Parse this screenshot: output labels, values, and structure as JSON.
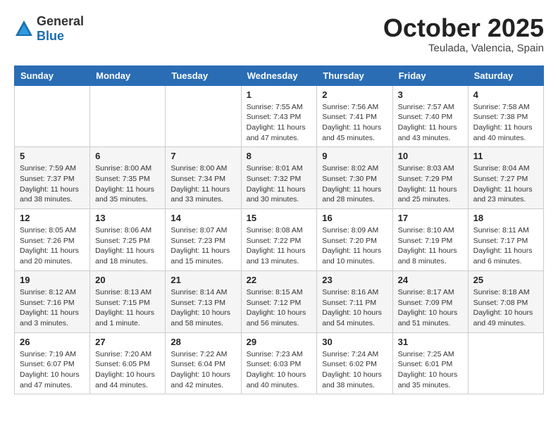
{
  "logo": {
    "text_general": "General",
    "text_blue": "Blue"
  },
  "header": {
    "month_year": "October 2025",
    "location": "Teulada, Valencia, Spain"
  },
  "weekdays": [
    "Sunday",
    "Monday",
    "Tuesday",
    "Wednesday",
    "Thursday",
    "Friday",
    "Saturday"
  ],
  "weeks": [
    [
      {
        "day": "",
        "info": ""
      },
      {
        "day": "",
        "info": ""
      },
      {
        "day": "",
        "info": ""
      },
      {
        "day": "1",
        "info": "Sunrise: 7:55 AM\nSunset: 7:43 PM\nDaylight: 11 hours\nand 47 minutes."
      },
      {
        "day": "2",
        "info": "Sunrise: 7:56 AM\nSunset: 7:41 PM\nDaylight: 11 hours\nand 45 minutes."
      },
      {
        "day": "3",
        "info": "Sunrise: 7:57 AM\nSunset: 7:40 PM\nDaylight: 11 hours\nand 43 minutes."
      },
      {
        "day": "4",
        "info": "Sunrise: 7:58 AM\nSunset: 7:38 PM\nDaylight: 11 hours\nand 40 minutes."
      }
    ],
    [
      {
        "day": "5",
        "info": "Sunrise: 7:59 AM\nSunset: 7:37 PM\nDaylight: 11 hours\nand 38 minutes."
      },
      {
        "day": "6",
        "info": "Sunrise: 8:00 AM\nSunset: 7:35 PM\nDaylight: 11 hours\nand 35 minutes."
      },
      {
        "day": "7",
        "info": "Sunrise: 8:00 AM\nSunset: 7:34 PM\nDaylight: 11 hours\nand 33 minutes."
      },
      {
        "day": "8",
        "info": "Sunrise: 8:01 AM\nSunset: 7:32 PM\nDaylight: 11 hours\nand 30 minutes."
      },
      {
        "day": "9",
        "info": "Sunrise: 8:02 AM\nSunset: 7:30 PM\nDaylight: 11 hours\nand 28 minutes."
      },
      {
        "day": "10",
        "info": "Sunrise: 8:03 AM\nSunset: 7:29 PM\nDaylight: 11 hours\nand 25 minutes."
      },
      {
        "day": "11",
        "info": "Sunrise: 8:04 AM\nSunset: 7:27 PM\nDaylight: 11 hours\nand 23 minutes."
      }
    ],
    [
      {
        "day": "12",
        "info": "Sunrise: 8:05 AM\nSunset: 7:26 PM\nDaylight: 11 hours\nand 20 minutes."
      },
      {
        "day": "13",
        "info": "Sunrise: 8:06 AM\nSunset: 7:25 PM\nDaylight: 11 hours\nand 18 minutes."
      },
      {
        "day": "14",
        "info": "Sunrise: 8:07 AM\nSunset: 7:23 PM\nDaylight: 11 hours\nand 15 minutes."
      },
      {
        "day": "15",
        "info": "Sunrise: 8:08 AM\nSunset: 7:22 PM\nDaylight: 11 hours\nand 13 minutes."
      },
      {
        "day": "16",
        "info": "Sunrise: 8:09 AM\nSunset: 7:20 PM\nDaylight: 11 hours\nand 10 minutes."
      },
      {
        "day": "17",
        "info": "Sunrise: 8:10 AM\nSunset: 7:19 PM\nDaylight: 11 hours\nand 8 minutes."
      },
      {
        "day": "18",
        "info": "Sunrise: 8:11 AM\nSunset: 7:17 PM\nDaylight: 11 hours\nand 6 minutes."
      }
    ],
    [
      {
        "day": "19",
        "info": "Sunrise: 8:12 AM\nSunset: 7:16 PM\nDaylight: 11 hours\nand 3 minutes."
      },
      {
        "day": "20",
        "info": "Sunrise: 8:13 AM\nSunset: 7:15 PM\nDaylight: 11 hours\nand 1 minute."
      },
      {
        "day": "21",
        "info": "Sunrise: 8:14 AM\nSunset: 7:13 PM\nDaylight: 10 hours\nand 58 minutes."
      },
      {
        "day": "22",
        "info": "Sunrise: 8:15 AM\nSunset: 7:12 PM\nDaylight: 10 hours\nand 56 minutes."
      },
      {
        "day": "23",
        "info": "Sunrise: 8:16 AM\nSunset: 7:11 PM\nDaylight: 10 hours\nand 54 minutes."
      },
      {
        "day": "24",
        "info": "Sunrise: 8:17 AM\nSunset: 7:09 PM\nDaylight: 10 hours\nand 51 minutes."
      },
      {
        "day": "25",
        "info": "Sunrise: 8:18 AM\nSunset: 7:08 PM\nDaylight: 10 hours\nand 49 minutes."
      }
    ],
    [
      {
        "day": "26",
        "info": "Sunrise: 7:19 AM\nSunset: 6:07 PM\nDaylight: 10 hours\nand 47 minutes."
      },
      {
        "day": "27",
        "info": "Sunrise: 7:20 AM\nSunset: 6:05 PM\nDaylight: 10 hours\nand 44 minutes."
      },
      {
        "day": "28",
        "info": "Sunrise: 7:22 AM\nSunset: 6:04 PM\nDaylight: 10 hours\nand 42 minutes."
      },
      {
        "day": "29",
        "info": "Sunrise: 7:23 AM\nSunset: 6:03 PM\nDaylight: 10 hours\nand 40 minutes."
      },
      {
        "day": "30",
        "info": "Sunrise: 7:24 AM\nSunset: 6:02 PM\nDaylight: 10 hours\nand 38 minutes."
      },
      {
        "day": "31",
        "info": "Sunrise: 7:25 AM\nSunset: 6:01 PM\nDaylight: 10 hours\nand 35 minutes."
      },
      {
        "day": "",
        "info": ""
      }
    ]
  ]
}
